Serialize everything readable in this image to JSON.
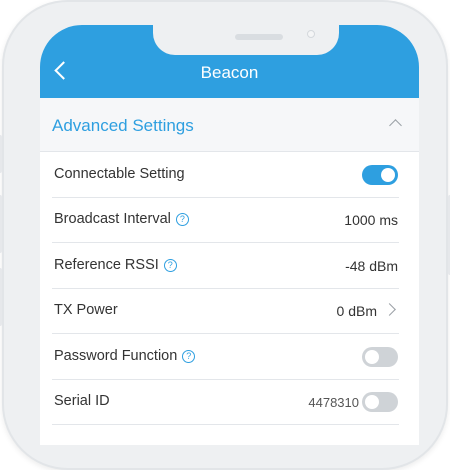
{
  "header": {
    "title": "Beacon",
    "back_icon": "chevron-left-icon"
  },
  "section": {
    "title": "Advanced Settings",
    "icon": "chevron-up-icon"
  },
  "rows": [
    {
      "label": "Connectable Setting",
      "control": "toggle",
      "enabled": true
    },
    {
      "label": "Broadcast Interval",
      "help": true,
      "value": "1000 ms"
    },
    {
      "label": "Reference RSSI",
      "help": true,
      "value": "-48 dBm"
    },
    {
      "label": "TX Power",
      "value": "0 dBm",
      "icon": "chevron-right-icon"
    },
    {
      "label": "Password Function",
      "help": true,
      "control": "toggle",
      "enabled": false
    },
    {
      "label": "Serial ID",
      "value": "4478310",
      "control": "toggle",
      "enabled": false
    }
  ],
  "help_glyph": "?",
  "colors": {
    "accent": "#2e9fe0",
    "toggle_off": "#cfd3d7",
    "text": "#333333"
  }
}
